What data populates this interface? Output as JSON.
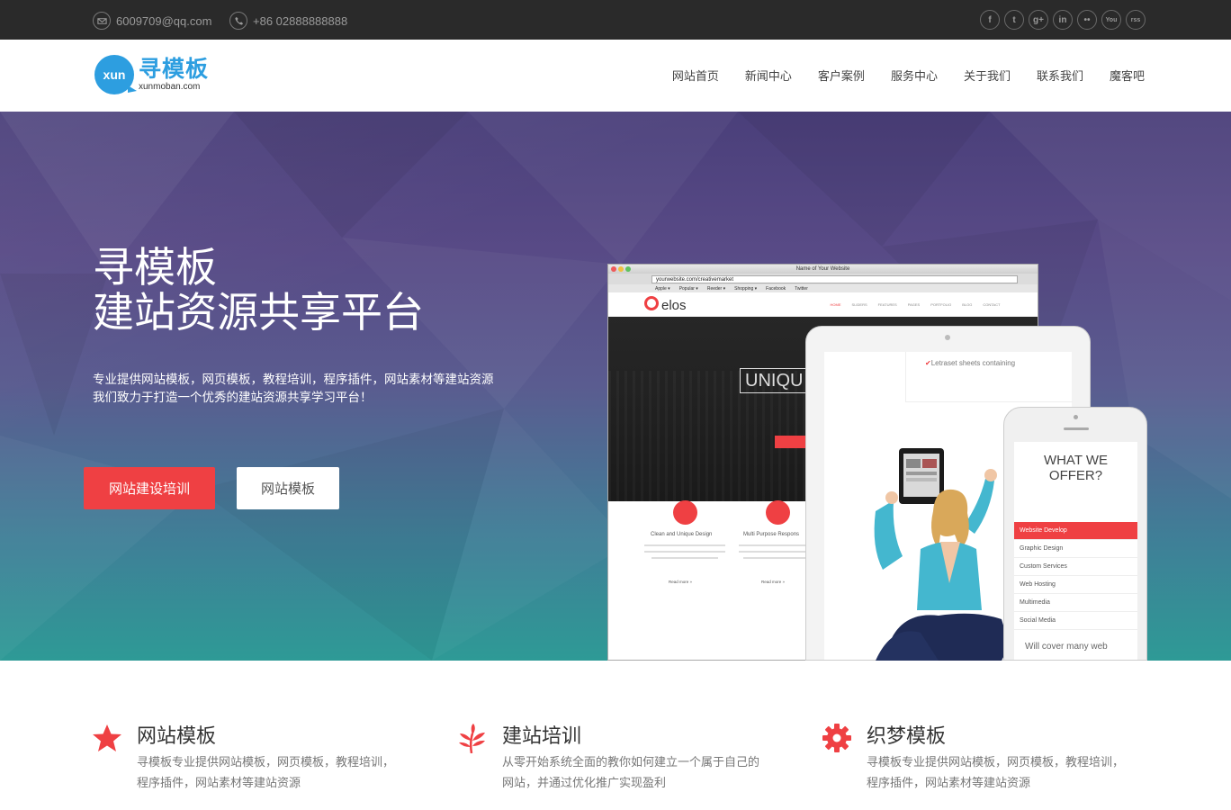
{
  "topbar": {
    "email": "6009709@qq.com",
    "phone": "+86 02888888888",
    "social_icons": [
      "facebook-icon",
      "twitter-icon",
      "google-plus-icon",
      "linkedin-icon",
      "flickr-icon",
      "youtube-icon",
      "rss-icon"
    ],
    "social_labels": [
      "f",
      "t",
      "g+",
      "in",
      "••",
      "You",
      "rss"
    ]
  },
  "header": {
    "logo_bubble": "xun",
    "logo_name": "寻模板",
    "logo_domain": "xunmoban.com",
    "nav": [
      "网站首页",
      "新闻中心",
      "客户案例",
      "服务中心",
      "关于我们",
      "联系我们",
      "魔客吧"
    ]
  },
  "hero": {
    "title_line1": "寻模板",
    "title_line2": "建站资源共享平台",
    "desc_line1": "专业提供网站模板，网页模板，教程培训，程序插件，网站素材等建站资源",
    "desc_line2": "我们致力于打造一个优秀的建站资源共享学习平台！",
    "btn_primary": "网站建设培训",
    "btn_secondary": "网站模板",
    "accent": "#ef4043"
  },
  "mockup": {
    "window_title": "Name of Your Website",
    "url": "yourwebsite.com/creativemarket",
    "bookmarks": [
      "Apple ▾",
      "Popular ▾",
      "Reeder ▾",
      "Shopping ▾",
      "Facebook",
      "Twitter"
    ],
    "brand": "elos",
    "site_menu": [
      "HOME",
      "SLIDERS",
      "FEATURES",
      "PAGES",
      "PORTFOLIO",
      "BLOG",
      "CONTACT"
    ],
    "hero_word": "UNIQU",
    "feature1": "Clean and Unique Design",
    "feature2": "Multi Purpose Respons",
    "read_more": "Read more »",
    "tablet_check": "Letraset sheets containing",
    "phone_heading_1": "WHAT WE",
    "phone_heading_2": "OFFER?",
    "phone_menu": [
      "Website Develop",
      "Graphic Design",
      "Custom Services",
      "Web Hosting",
      "Multimedia",
      "Social Media"
    ],
    "phone_footer": "Will cover many web"
  },
  "features": [
    {
      "icon": "star-icon",
      "title": "网站模板",
      "line1": "寻模板专业提供网站模板，网页模板，教程培训，",
      "line2": "程序插件，网站素材等建站资源"
    },
    {
      "icon": "leaf-icon",
      "title": "建站培训",
      "line1": "从零开始系统全面的教你如何建立一个属于自己的",
      "line2": "网站，并通过优化推广实现盈利"
    },
    {
      "icon": "gear-icon",
      "title": "织梦模板",
      "line1": "寻模板专业提供网站模板，网页模板，教程培训，",
      "line2": "程序插件，网站素材等建站资源"
    }
  ]
}
